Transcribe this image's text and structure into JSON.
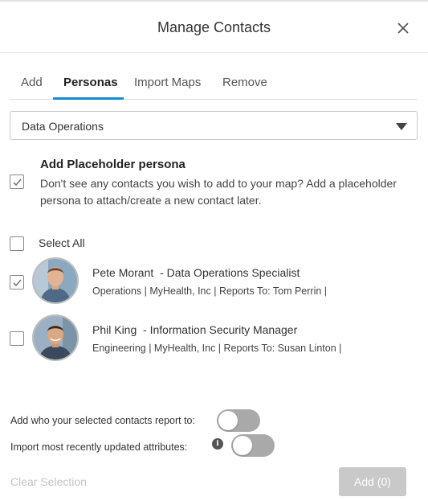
{
  "dialog": {
    "title": "Manage Contacts",
    "close_icon": "close-icon"
  },
  "tabs": [
    {
      "label": "Add",
      "active": false
    },
    {
      "label": "Personas",
      "active": true
    },
    {
      "label": "Import Maps",
      "active": false
    },
    {
      "label": "Remove",
      "active": false
    }
  ],
  "accent_color": "#1a8ad0",
  "persona_select": {
    "value": "Data Operations",
    "icon": "caret-down-icon"
  },
  "placeholder": {
    "checked": true,
    "title": "Add Placeholder persona",
    "description": "Don't see any contacts you wish to add to your map? Add a placeholder persona to attach/create a new contact later."
  },
  "select_all": {
    "label": "Select All",
    "checked": false
  },
  "contacts": [
    {
      "name": "Pete Morant",
      "title_text": "  - Data Operations Specialist",
      "meta": "Operations | MyHealth, Inc | Reports To: Tom Perrin |",
      "checked": true
    },
    {
      "name": "Phil King",
      "title_text": "  - Information Security Manager",
      "meta": "Engineering | MyHealth, Inc | Reports To: Susan Linton |",
      "checked": false
    }
  ],
  "options": {
    "report_to_label": "Add who your selected contacts report to:",
    "report_to_on": false,
    "import_attr_label": "Import most recently updated attributes:",
    "import_attr_on": false,
    "info_icon_glyph": "i"
  },
  "footer": {
    "clear_label": "Clear Selection",
    "add_label": "Add (0)"
  }
}
